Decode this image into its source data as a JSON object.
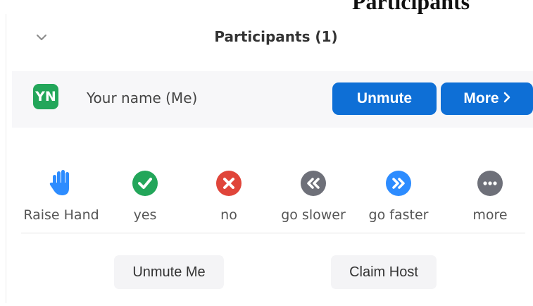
{
  "doc_heading": "Participants",
  "panel": {
    "title": "Participants (1)",
    "collapse_icon": "chevron-down-icon"
  },
  "participant": {
    "initials": "YN",
    "name": "Your name (Me)",
    "avatar_color": "#23a65a"
  },
  "actions": {
    "unmute_label": "Unmute",
    "more_label": "More",
    "more_icon": "chevron-right-icon"
  },
  "reactions": [
    {
      "label": "Raise Hand",
      "icon": "raised-hand-icon",
      "color": "#2d8cff"
    },
    {
      "label": "yes",
      "icon": "checkmark-icon",
      "color": "#23a65a"
    },
    {
      "label": "no",
      "icon": "x-mark-icon",
      "color": "#e0453a"
    },
    {
      "label": "go slower",
      "icon": "double-chevron-left-icon",
      "color": "#6e7079"
    },
    {
      "label": "go faster",
      "icon": "double-chevron-right-icon",
      "color": "#2d8cff"
    },
    {
      "label": "more",
      "icon": "ellipsis-icon",
      "color": "#6e7079"
    }
  ],
  "footer": {
    "unmute_me_label": "Unmute Me",
    "claim_host_label": "Claim Host"
  },
  "colors": {
    "primary_blue": "#0e6fd6",
    "row_bg": "#f7f7f9",
    "button_gray": "#f4f4f6"
  }
}
